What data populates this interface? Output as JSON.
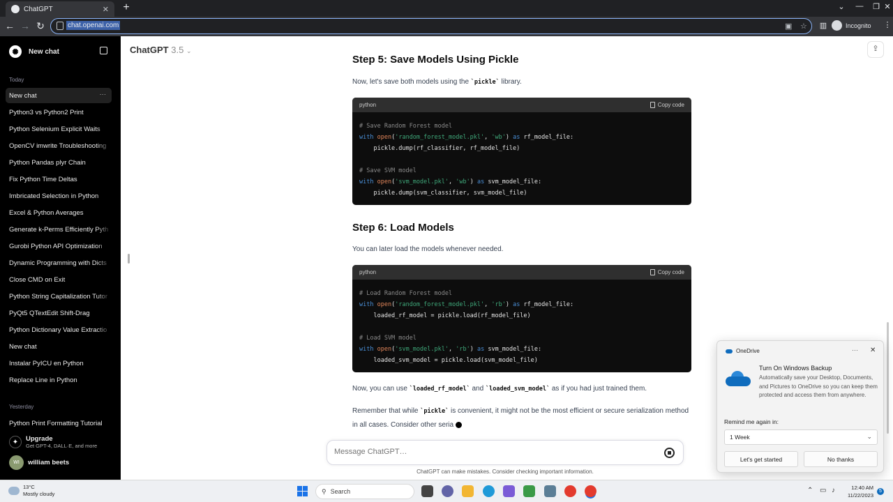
{
  "browser": {
    "tab_title": "ChatGPT",
    "url": "chat.openai.com",
    "profile_label": "Incognito"
  },
  "sidebar": {
    "new_chat": "New chat",
    "section_today": "Today",
    "today_items": [
      {
        "label": "New chat"
      },
      {
        "label": "Python3 vs Python2 Print"
      },
      {
        "label": "Python Selenium Explicit Waits"
      },
      {
        "label": "OpenCV imwrite Troubleshooting"
      },
      {
        "label": "Python Pandas plyr Chain"
      },
      {
        "label": "Fix Python Time Deltas"
      },
      {
        "label": "Imbricated Selection in Python"
      },
      {
        "label": "Excel & Python Averages"
      },
      {
        "label": "Generate k-Perms Efficiently Pyth"
      },
      {
        "label": "Gurobi Python API Optimization"
      },
      {
        "label": "Dynamic Programming with Dicts"
      },
      {
        "label": "Close CMD on Exit"
      },
      {
        "label": "Python String Capitalization Tutor"
      },
      {
        "label": "PyQt5 QTextEdit Shift-Drag"
      },
      {
        "label": "Python Dictionary Value Extractio"
      },
      {
        "label": "New chat"
      },
      {
        "label": "Instalar PyICU en Python"
      },
      {
        "label": "Replace Line in Python"
      }
    ],
    "section_yesterday": "Yesterday",
    "yesterday_items": [
      {
        "label": "Python Print Formatting Tutorial"
      }
    ],
    "upgrade_title": "Upgrade",
    "upgrade_sub": "Get GPT-4, DALL·E, and more",
    "user_initials": "WI",
    "user_name": "william beets"
  },
  "header": {
    "model_name": "ChatGPT",
    "model_version": "3.5"
  },
  "conversation": {
    "step5_heading": "Step 5: Save Models Using Pickle",
    "step5_intro_a": "Now, let's save both models using the ",
    "step5_intro_code": "`pickle`",
    "step5_intro_b": " library.",
    "code1_lang": "python",
    "copy_label": "Copy code",
    "code1_lines": [
      "# Save Random Forest model",
      "with open('random_forest_model.pkl', 'wb') as rf_model_file:",
      "    pickle.dump(rf_classifier, rf_model_file)",
      "",
      "# Save SVM model",
      "with open('svm_model.pkl', 'wb') as svm_model_file:",
      "    pickle.dump(svm_classifier, svm_model_file)"
    ],
    "step6_heading": "Step 6: Load Models",
    "step6_intro": "You can later load the models whenever needed.",
    "code2_lang": "python",
    "code2_lines": [
      "# Load Random Forest model",
      "with open('random_forest_model.pkl', 'rb') as rf_model_file:",
      "    loaded_rf_model = pickle.load(rf_model_file)",
      "",
      "# Load SVM model",
      "with open('svm_model.pkl', 'rb') as svm_model_file:",
      "    loaded_svm_model = pickle.load(svm_model_file)"
    ],
    "use_a": "Now, you can use ",
    "use_code1": "`loaded_rf_model`",
    "use_b": " and ",
    "use_code2": "`loaded_svm_model`",
    "use_c": " as if you had just trained them.",
    "remember_a": "Remember that while ",
    "remember_code": "`pickle`",
    "remember_b": " is convenient, it might not be the most efficient or secure serialization method in all cases. Consider other seria"
  },
  "composer": {
    "placeholder": "Message ChatGPT…",
    "disclaimer": "ChatGPT can make mistakes. Consider checking important information."
  },
  "toast": {
    "app": "OneDrive",
    "title": "Turn On Windows Backup",
    "body": "Automatically save your Desktop, Documents, and Pictures to OneDrive so you can keep them protected and access them from anywhere.",
    "remind_label": "Remind me again in:",
    "remind_value": "1 Week",
    "primary_button": "Let's get started",
    "secondary_button": "No thanks"
  },
  "taskbar": {
    "temperature": "13°C",
    "weather": "Mostly cloudy",
    "search_placeholder": "Search",
    "time": "12:40 AM",
    "date": "11/22/2023",
    "notification_count": "5"
  },
  "colors": {
    "sidebar_bg": "#000000",
    "code_bg": "#0d0d0d",
    "code_keyword": "#4a8fd7",
    "code_string": "#3fa87a",
    "code_function": "#e0855a",
    "code_comment": "#8b8b8b",
    "accent_blue": "#0f6cbd"
  }
}
